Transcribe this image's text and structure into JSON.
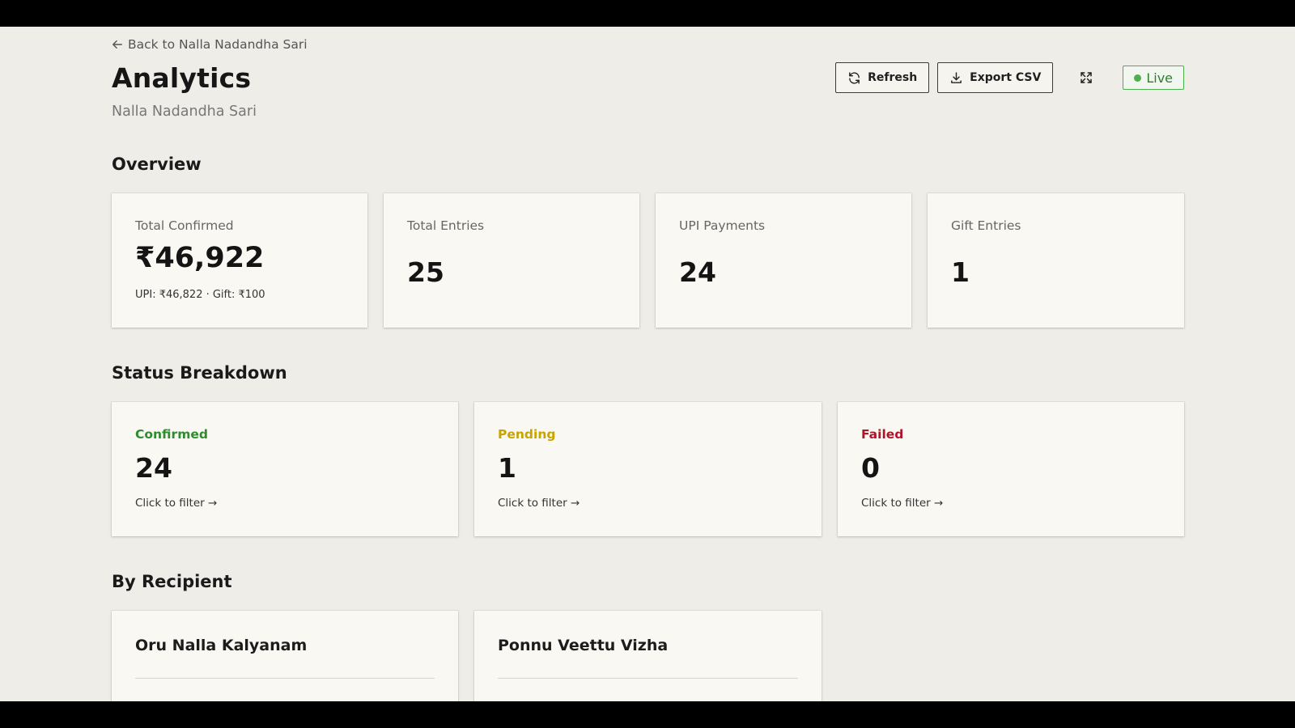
{
  "header": {
    "back_label": "Back to Nalla Nadandha Sari",
    "title": "Analytics",
    "subtitle": "Nalla Nadandha Sari"
  },
  "toolbar": {
    "refresh_label": "Refresh",
    "export_label": "Export CSV",
    "live_label": "Live"
  },
  "overview": {
    "title": "Overview",
    "cards": [
      {
        "label": "Total Confirmed",
        "value": "₹46,922",
        "note": "UPI: ₹46,822 · Gift: ₹100"
      },
      {
        "label": "Total Entries",
        "value": "25"
      },
      {
        "label": "UPI Payments",
        "value": "24"
      },
      {
        "label": "Gift Entries",
        "value": "1"
      }
    ]
  },
  "status": {
    "title": "Status Breakdown",
    "cards": [
      {
        "label": "Confirmed",
        "value": "24",
        "filter": "Click to filter →",
        "color": "#2e8b2e"
      },
      {
        "label": "Pending",
        "value": "1",
        "filter": "Click to filter →",
        "color": "#c9a400"
      },
      {
        "label": "Failed",
        "value": "0",
        "filter": "Click to filter →",
        "color": "#b3122b"
      }
    ]
  },
  "recipients": {
    "title": "By Recipient",
    "items": [
      {
        "name": "Oru Nalla Kalyanam"
      },
      {
        "name": "Ponnu Veettu Vizha"
      }
    ]
  }
}
